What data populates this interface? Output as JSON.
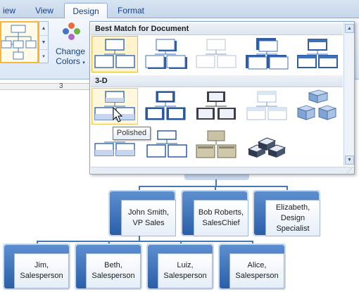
{
  "ribbon": {
    "tabs": [
      {
        "label": "View",
        "display": "iew"
      },
      {
        "label": "View"
      },
      {
        "label": "Design",
        "active": true
      },
      {
        "label": "Format"
      }
    ],
    "change_colors": {
      "line1": "Change",
      "line2": "Colors",
      "arrow": "▾"
    },
    "ruler_number": "3"
  },
  "gallery": {
    "section_best_match": "Best Match for Document",
    "section_3d": "3-D",
    "tooltip": "Polished",
    "best_match_count": 5,
    "three_d_count": 10,
    "selected_best_match_index": 0,
    "hover_3d_index": 0
  },
  "org_chart": {
    "managers": [
      {
        "line1": "John Smith,",
        "line2": "VP Sales"
      },
      {
        "line1": "Bob Roberts,",
        "line2": "SalesChief"
      },
      {
        "line1": "Elizabeth,",
        "line2": "Design",
        "line3": "Specialist"
      }
    ],
    "salespeople": [
      {
        "line1": "Jim,",
        "line2": "Salesperson"
      },
      {
        "line1": "Beth,",
        "line2": "Salesperson"
      },
      {
        "line1": "Luiz,",
        "line2": "Salesperson"
      },
      {
        "line1": "Alice,",
        "line2": "Salesperson"
      }
    ]
  },
  "colors": {
    "accent_blue": "#2a5ea8",
    "node_blue": "#5d8fcf",
    "ribbon_text": "#15428b",
    "selection_gold": "#e7b43a",
    "color_dots": [
      "#f06a3c",
      "#6bb543",
      "#4472c4",
      "#b065c8"
    ]
  }
}
